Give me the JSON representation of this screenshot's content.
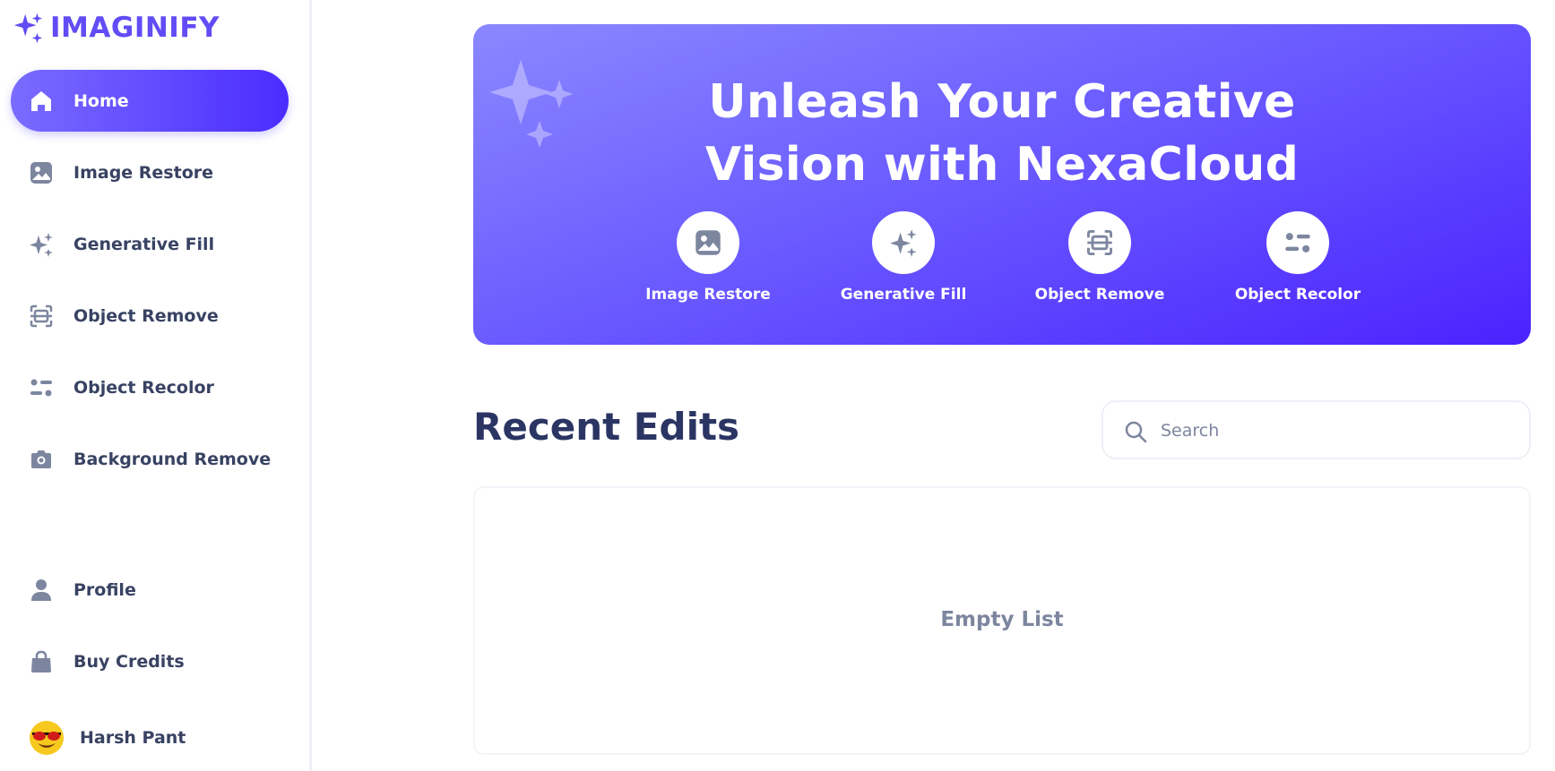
{
  "app": {
    "name": "IMAGINIFY"
  },
  "sidebar": {
    "items": [
      {
        "label": "Home",
        "icon": "home-icon",
        "active": true
      },
      {
        "label": "Image Restore",
        "icon": "image-icon"
      },
      {
        "label": "Generative Fill",
        "icon": "sparkles-icon"
      },
      {
        "label": "Object Remove",
        "icon": "scan-icon"
      },
      {
        "label": "Object Recolor",
        "icon": "filter-icon"
      },
      {
        "label": "Background Remove",
        "icon": "camera-icon"
      }
    ],
    "bottom_items": [
      {
        "label": "Profile",
        "icon": "user-icon"
      },
      {
        "label": "Buy Credits",
        "icon": "bag-icon"
      }
    ],
    "user": {
      "name": "Harsh Pant",
      "avatar": "sunglasses-emoji-avatar"
    }
  },
  "hero": {
    "title_line1": "Unleash Your Creative",
    "title_line2": "Vision with NexaCloud",
    "features": [
      {
        "label": "Image Restore",
        "icon": "image-icon"
      },
      {
        "label": "Generative Fill",
        "icon": "sparkles-icon"
      },
      {
        "label": "Object Remove",
        "icon": "scan-icon"
      },
      {
        "label": "Object Recolor",
        "icon": "filter-icon"
      }
    ]
  },
  "recent": {
    "title": "Recent Edits",
    "search_placeholder": "Search",
    "empty_text": "Empty List"
  },
  "colors": {
    "brand": "#624cf5",
    "gradient_start": "#8a88ff",
    "gradient_end": "#4b22ff",
    "text_dark": "#2b3563",
    "text_muted": "#7d869f",
    "icon_gray": "#7d869f"
  }
}
